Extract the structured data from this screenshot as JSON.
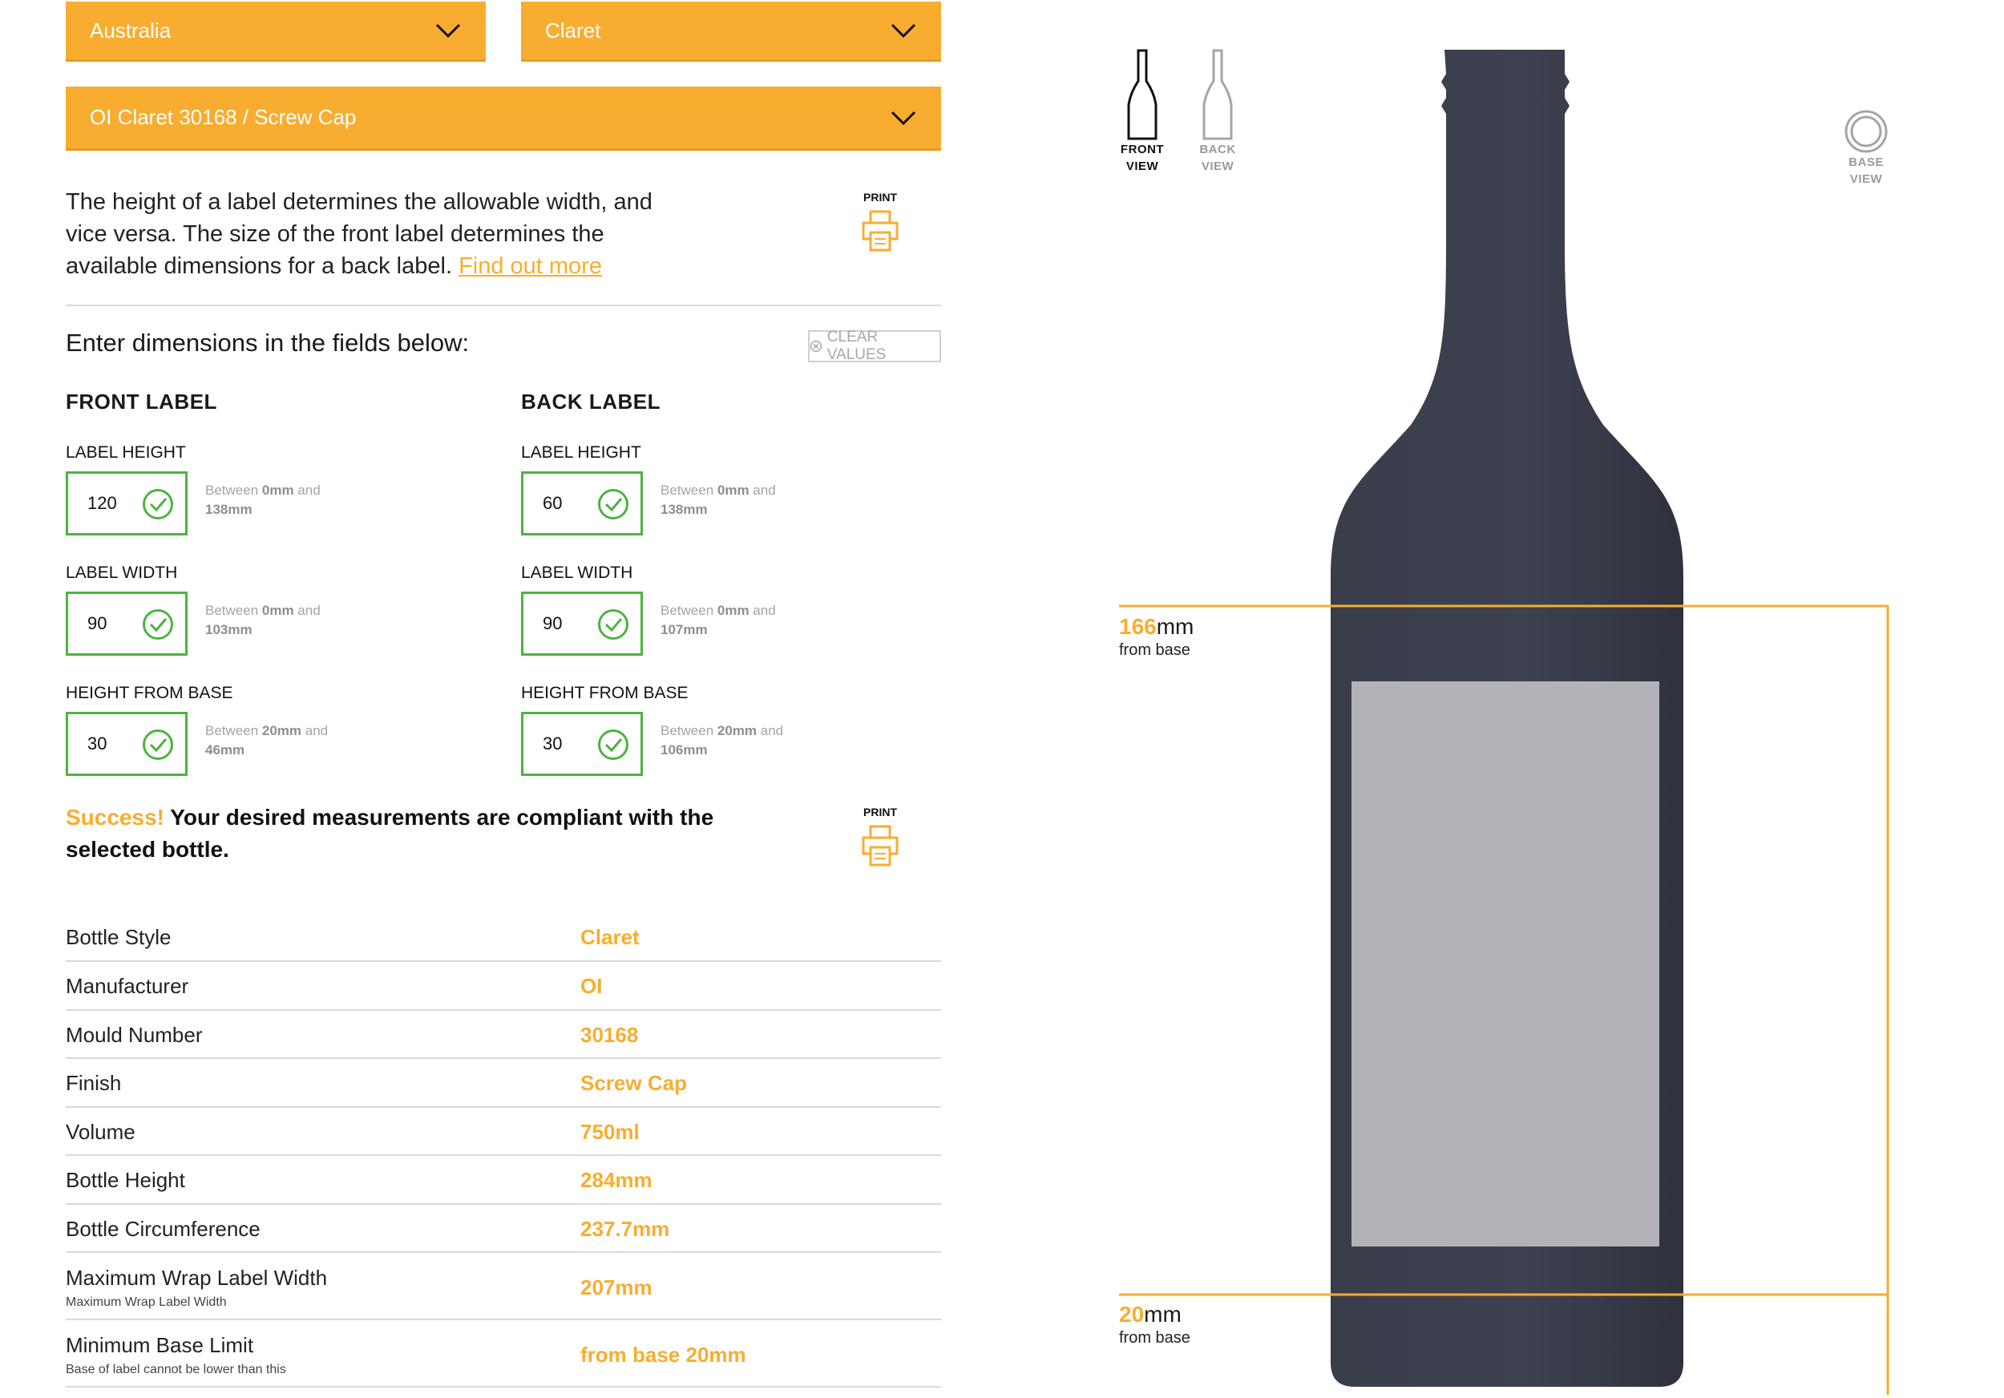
{
  "filters": {
    "country": "Australia",
    "style": "Claret",
    "bottle": "OI Claret 30168 / Screw Cap"
  },
  "intro": {
    "text": "The height of a label determines the allowable width, and vice versa. The size of the front label determines the available dimensions for a back label.",
    "link": "Find out more"
  },
  "print_label": "PRINT",
  "form": {
    "title": "Enter dimensions in the fields below:",
    "clear_label": "CLEAR VALUES",
    "front": {
      "title": "FRONT LABEL",
      "fields": [
        {
          "label": "LABEL HEIGHT",
          "value": "120",
          "hint_pre": "Between ",
          "hint_min": "0mm",
          "hint_mid": " and",
          "hint_max": "138mm"
        },
        {
          "label": "LABEL WIDTH",
          "value": "90",
          "hint_pre": "Between ",
          "hint_min": "0mm",
          "hint_mid": " and",
          "hint_max": "103mm"
        },
        {
          "label": "HEIGHT FROM BASE",
          "value": "30",
          "hint_pre": "Between ",
          "hint_min": "20mm",
          "hint_mid": " and",
          "hint_max": "46mm"
        }
      ]
    },
    "back": {
      "title": "BACK LABEL",
      "fields": [
        {
          "label": "LABEL HEIGHT",
          "value": "60",
          "hint_pre": "Between ",
          "hint_min": "0mm",
          "hint_mid": " and",
          "hint_max": "138mm"
        },
        {
          "label": "LABEL WIDTH",
          "value": "90",
          "hint_pre": "Between ",
          "hint_min": "0mm",
          "hint_mid": " and",
          "hint_max": "107mm"
        },
        {
          "label": "HEIGHT FROM BASE",
          "value": "30",
          "hint_pre": "Between ",
          "hint_min": "20mm",
          "hint_mid": " and",
          "hint_max": "106mm"
        }
      ]
    }
  },
  "result": {
    "highlight": "Success!",
    "message": "Your desired measurements are compliant with the selected bottle."
  },
  "specs": [
    {
      "name": "Bottle Style",
      "value": "Claret"
    },
    {
      "name": "Manufacturer",
      "value": "OI"
    },
    {
      "name": "Mould Number",
      "value": "30168"
    },
    {
      "name": "Finish",
      "value": "Screw Cap"
    },
    {
      "name": "Volume",
      "value": "750ml"
    },
    {
      "name": "Bottle Height",
      "value": "284mm"
    },
    {
      "name": "Bottle Circumference",
      "value": "237.7mm"
    },
    {
      "name": "Maximum Wrap Label Width",
      "sub": "Maximum Wrap Label Width",
      "value": "207mm"
    },
    {
      "name": "Minimum Base Limit",
      "sub": "Base of label cannot be lower than this",
      "value": "from base 20mm"
    }
  ],
  "views": {
    "front": {
      "line1": "FRONT",
      "line2": "VIEW",
      "icon": "bottle-front-icon",
      "active": true
    },
    "back": {
      "line1": "BACK",
      "line2": "VIEW",
      "icon": "bottle-back-icon",
      "active": false
    },
    "base": {
      "line1": "BASE",
      "line2": "VIEW",
      "icon": "bottle-base-icon",
      "active": false
    }
  },
  "measurements": {
    "top": {
      "value": "166",
      "unit": "mm",
      "sub": "from base"
    },
    "bottom": {
      "value": "20",
      "unit": "mm",
      "sub": "from base"
    }
  },
  "colors": {
    "accent": "#f8ad30",
    "valid": "#4cb43f",
    "bottle": "#3a3d4a",
    "label_area": "#b3b3b7"
  }
}
